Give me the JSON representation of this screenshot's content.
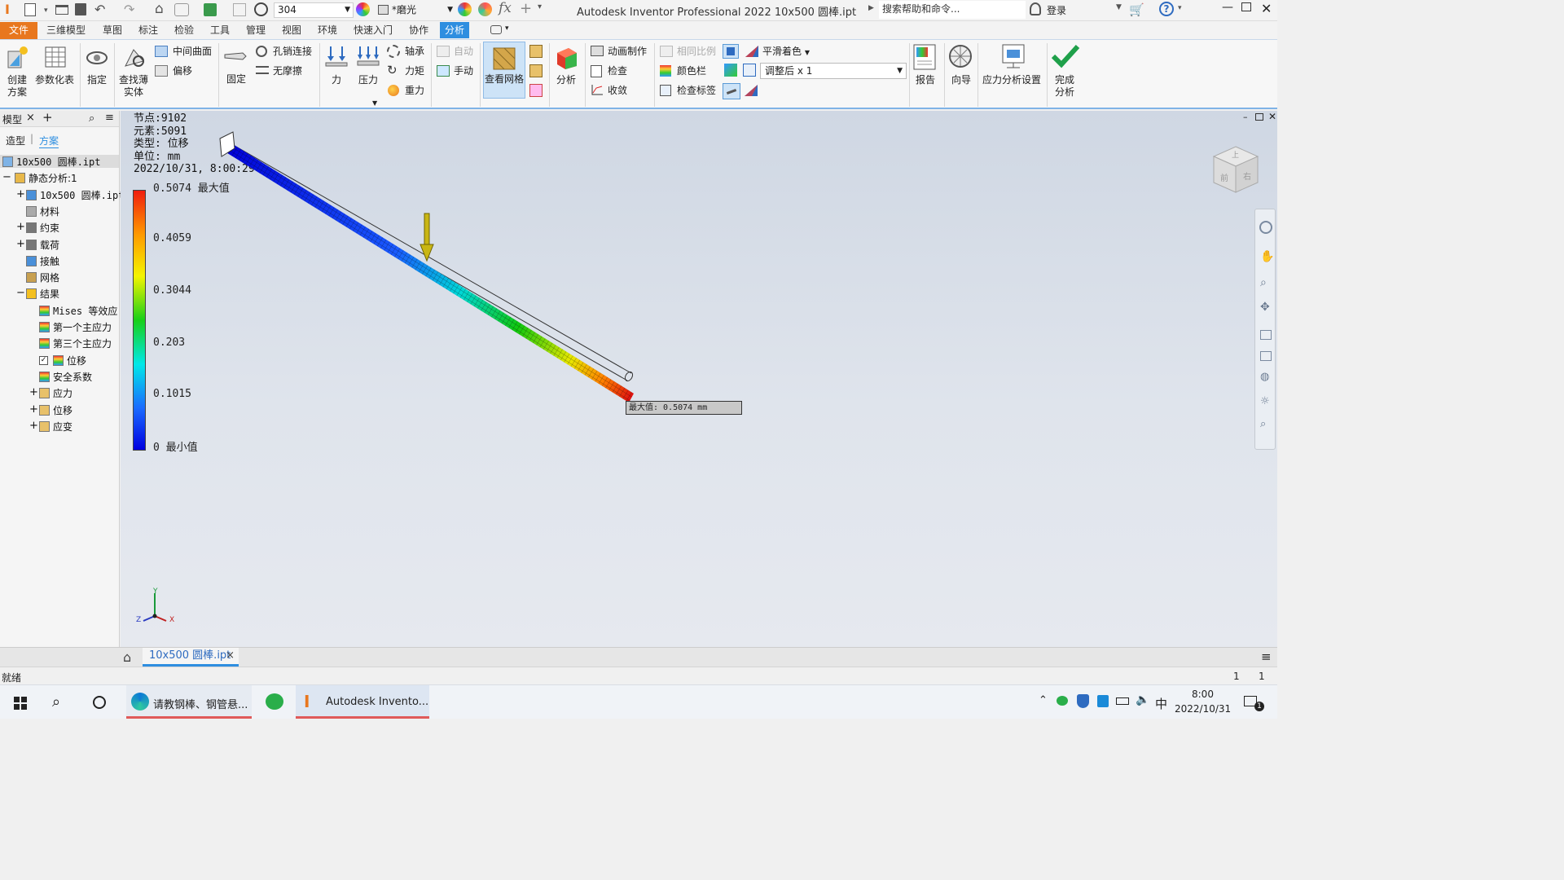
{
  "titlebar": {
    "mat_value": "304",
    "appearance": "*磨光",
    "title": "Autodesk Inventor Professional 2022    10x500 圆棒.ipt",
    "search_placeholder": "搜索帮助和命令...",
    "login": "登录"
  },
  "menu": {
    "file": "文件",
    "tabs": [
      "三维模型",
      "草图",
      "标注",
      "检验",
      "工具",
      "管理",
      "视图",
      "环境",
      "快速入门",
      "协作"
    ],
    "active": "分析"
  },
  "ribbon": {
    "create_scheme": [
      "创建",
      "方案"
    ],
    "parametric": "参数化表",
    "assign": "指定",
    "find_thin": [
      "查找薄",
      "实体"
    ],
    "mid_surface": "中间曲面",
    "offset": "偏移",
    "fixed": "固定",
    "pin": "孔销连接",
    "frictionless": "无摩擦",
    "force": "力",
    "pressure": "压力",
    "bearing": "轴承",
    "moment": "力矩",
    "gravity": "重力",
    "auto": "自动",
    "manual": "手动",
    "view_mesh": "查看网格",
    "analyze": "分析",
    "animate": "动画制作",
    "check": "检查",
    "converge": "收敛",
    "same_scale": "相同比例",
    "color_bar": "颜色栏",
    "probe_label": "检查标签",
    "smooth_shading": "平滑着色",
    "adjusted": "调整后 x 1",
    "report": "报告",
    "guide": "向导",
    "stress_settings": "应力分析设置",
    "finish": [
      "完成",
      "分析"
    ]
  },
  "panel": {
    "title": "模型",
    "close": "×",
    "add": "+",
    "tab_model": "造型",
    "tab_scheme": "方案",
    "tree": [
      {
        "label": "10x500 圆棒.ipt",
        "indent": 0,
        "exp": ""
      },
      {
        "label": "静态分析:1",
        "indent": 0,
        "exp": "−"
      },
      {
        "label": "10x500 圆棒.ipt",
        "indent": 1,
        "exp": "+"
      },
      {
        "label": "材料",
        "indent": 1,
        "exp": ""
      },
      {
        "label": "约束",
        "indent": 1,
        "exp": "+"
      },
      {
        "label": "载荷",
        "indent": 1,
        "exp": "+"
      },
      {
        "label": "接触",
        "indent": 1,
        "exp": ""
      },
      {
        "label": "网格",
        "indent": 1,
        "exp": ""
      },
      {
        "label": "结果",
        "indent": 1,
        "exp": "−"
      },
      {
        "label": "Mises 等效应",
        "indent": 2,
        "exp": ""
      },
      {
        "label": "第一个主应力",
        "indent": 2,
        "exp": ""
      },
      {
        "label": "第三个主应力",
        "indent": 2,
        "exp": ""
      },
      {
        "label": "位移",
        "indent": 2,
        "exp": "",
        "checked": true
      },
      {
        "label": "安全系数",
        "indent": 2,
        "exp": ""
      },
      {
        "label": "应力",
        "indent": 2,
        "exp": "+"
      },
      {
        "label": "位移",
        "indent": 2,
        "exp": "+"
      },
      {
        "label": "应变",
        "indent": 2,
        "exp": "+"
      }
    ]
  },
  "viewport": {
    "info": [
      "节点:9102",
      "元素:5091",
      "类型: 位移",
      "单位: mm",
      "2022/10/31, 8:00:29"
    ],
    "legend": [
      {
        "value": "0.5074",
        "suffix": "最大值"
      },
      {
        "value": "0.4059",
        "suffix": ""
      },
      {
        "value": "0.3044",
        "suffix": ""
      },
      {
        "value": "0.203",
        "suffix": ""
      },
      {
        "value": "0.1015",
        "suffix": ""
      },
      {
        "value": "0",
        "suffix": "最小值"
      }
    ],
    "max_label": "最大值: 0.5074 mm",
    "cube_faces": [
      "上",
      "前",
      "右"
    ],
    "axes": [
      "Y",
      "Z",
      "X"
    ]
  },
  "docbar": {
    "tab": "10x500 圆棒.ipt",
    "close": "×"
  },
  "status": {
    "text": "就绪",
    "n1": "1",
    "n2": "1"
  },
  "taskbar": {
    "edge_label": "请教钢棒、钢管悬...",
    "inventor_label": "Autodesk Invento...",
    "ime": "中",
    "time": "8:00",
    "date": "2022/10/31",
    "notif": "1"
  },
  "colors": {
    "accent": "#2e8ee0",
    "active_tab": "#2e8ee0"
  }
}
